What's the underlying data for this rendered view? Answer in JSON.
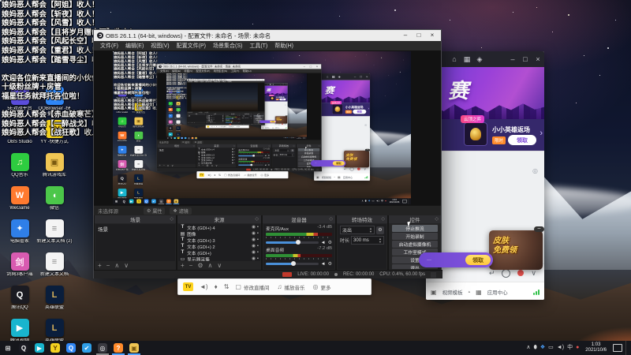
{
  "desktop": {
    "chat_lines": [
      "娘妈恶人帮会【阿姐】收人！",
      "娘妈恶人帮会【斩夜】收人！",
      "娘妈恶人帮会【风雪】收人！",
      "娘妈恶人帮会【且将岁月赠山河】收人！",
      "娘妈恶人帮会【风起长空】收人！",
      "娘妈恶人帮会【重君】收人！",
      "娘妈恶人帮会【踏雪寻尘】收人！",
      "",
      "欢迎各位新来直播间的小伙伴",
      "十级粉丝牌＋房管",
      "福星任务就拜托各位啦！",
      "",
      "娘妈恶人帮会【赤血破寒芒】收人！",
      "娘妈恶人帮会【一醉战戈】收人！",
      "娘妈恶人帮会【战狂歌】收人！"
    ],
    "icons_col1": [
      {
        "label": "5E对战平台",
        "glyph": "5E",
        "color": "#5b4ddb",
        "fg": "#ffffff"
      },
      {
        "label": "OBS Studio",
        "glyph": "◎",
        "color": "#17171d",
        "fg": "#ffffff"
      },
      {
        "label": "QQ音乐",
        "glyph": "♫",
        "color": "#2ecc40",
        "fg": "#fff7c0"
      },
      {
        "label": "WeGame",
        "glyph": "W",
        "color": "#ff7a2f",
        "fg": "#ffffff"
      },
      {
        "label": "电脑管家",
        "glyph": "✦",
        "color": "#2f7fe8",
        "fg": "#ffffff"
      },
      {
        "label": "剑网3客户端",
        "glyph": "剑",
        "color": "#d85bb0",
        "fg": "#ffe9f6"
      },
      {
        "label": "腾讯QQ",
        "glyph": "Q",
        "color": "#1b1b22",
        "fg": "#ffffff"
      },
      {
        "label": "腾讯视频",
        "glyph": "▶",
        "color": "#19b5ce",
        "fg": "#ffffff"
      }
    ],
    "icons_col2": [
      {
        "label": "QQBrowser -快捷方式",
        "glyph": "Q",
        "color": "#2f86f6",
        "fg": "#ffffff"
      },
      {
        "label": "YY -快捷方式",
        "glyph": "YY",
        "color": "#f4d21f",
        "fg": "#5a3a00"
      },
      {
        "label": "腾讯游戏库",
        "glyph": "▣",
        "color": "#f0c654",
        "fg": "#7a5a10"
      },
      {
        "label": "微信",
        "glyph": "◖",
        "color": "#4cc74a",
        "fg": "#ffffff"
      },
      {
        "label": "新建文本文档 (2)",
        "glyph": "≡",
        "color": "#f4f4f4",
        "fg": "#8a8a8a"
      },
      {
        "label": "新建文本文档",
        "glyph": "≡",
        "color": "#f4f4f4",
        "fg": "#8a8a8a"
      },
      {
        "label": "英雄联盟",
        "glyph": "L",
        "color": "#0a1e3c",
        "fg": "#d8b25a"
      },
      {
        "label": "英雄联盟WeGame版",
        "glyph": "L",
        "color": "#0a1e3c",
        "fg": "#d8b25a"
      }
    ]
  },
  "obs": {
    "title": "OBS 26.1.1 (64-bit, windows) - 配置文件: 未命名 - 场景: 未命名",
    "window_controls": {
      "min": "–",
      "max": "□",
      "close": "×"
    },
    "menus": [
      "文件(F)",
      "编辑(E)",
      "视图(V)",
      "配置文件(P)",
      "场景集合(S)",
      "工具(T)",
      "帮助(H)"
    ],
    "context_bar": {
      "no_source": "未选择源",
      "properties": "属性",
      "filters": "滤镜",
      "gear_icon": "⚙",
      "filter_icon": "❖"
    },
    "scenes": {
      "header": "场景",
      "items": [
        {
          "label": "场景"
        }
      ],
      "tools": [
        "+",
        "−",
        "∧",
        "∨"
      ]
    },
    "sources": {
      "header": "来源",
      "eye": "◉",
      "lock": "▪",
      "items": [
        {
          "glyph": "T",
          "label": "文本 (GDI+) 4"
        },
        {
          "glyph": "▤",
          "label": "图像"
        },
        {
          "glyph": "T",
          "label": "文本 (GDI+) 3"
        },
        {
          "glyph": "T",
          "label": "文本 (GDI+) 2"
        },
        {
          "glyph": "T",
          "label": "文本 (GDI+)"
        },
        {
          "glyph": "▭",
          "label": "显示器采集"
        }
      ],
      "tools": [
        "+",
        "−",
        "⚙",
        "∧",
        "∨"
      ]
    },
    "mixer": {
      "header": "混音器",
      "channels": [
        {
          "name": "麦克风/Aux",
          "db": "-3.4 dB",
          "level": "78%",
          "slider": "62%"
        },
        {
          "name": "桌面音频",
          "db": "-7.2 dB",
          "level": "52%",
          "slider": "52%"
        }
      ],
      "speaker_icon": "◄",
      "gear_icon": "⚙"
    },
    "transitions": {
      "header": "转场特效",
      "selected": "淡出",
      "duration_label": "时长",
      "duration_value": "300 ms",
      "gear_icon": "⚙"
    },
    "controls": {
      "header": "控件",
      "buttons": [
        {
          "label": "停止推流",
          "bg": "#5a5e64"
        },
        {
          "label": "开始录制",
          "bg": "#3e3e42"
        },
        {
          "label": "启动虚拟摄像机",
          "bg": "#3e3e42"
        },
        {
          "label": "工作室模式",
          "bg": "#3e3e42"
        },
        {
          "label": "设置",
          "bg": "#3e3e42"
        },
        {
          "label": "退出",
          "bg": "#3e3e42"
        }
      ]
    },
    "statusbar": {
      "live": "LIVE: 00:00:00",
      "rec": "REC: 00:00:00",
      "cpu": "CPU: 0.4%, 60.00 fps"
    }
  },
  "stream_toolbar": {
    "icons": {
      "speaker": "◄)",
      "mic": "♦",
      "sliders": "⇅"
    },
    "items": [
      {
        "glyph": "▢",
        "label": "修改直播间"
      },
      {
        "glyph": "♫",
        "label": "播放音乐"
      },
      {
        "glyph": "◎",
        "label": "更多"
      }
    ]
  },
  "right_app": {
    "topbar_icons": {
      "home": "⌂",
      "grid": "▦",
      "game": "◈",
      "min": "–",
      "max": "□",
      "close": "×"
    },
    "banner_title": "赛",
    "card": {
      "tag": "云顶之弈",
      "title": "小小英雄返场",
      "sub_tag": "限时",
      "button": "领取",
      "chevron": "›"
    },
    "pin_icon": "◎",
    "input_icons": {
      "enter": "↵",
      "caret": "∨"
    },
    "ad": {
      "line1": "皮肤",
      "line2": "免费领",
      "close": "–"
    },
    "toast": {
      "text": "···",
      "button": "领取"
    },
    "bottom_bar": {
      "cam_icon": "▣",
      "left": "视频模板",
      "caret": "▴",
      "grid_icon": "▦",
      "center": "应用中心"
    }
  },
  "taskbar": {
    "apps": [
      {
        "glyph": "⊞",
        "fg": "#ffffff",
        "bg": "transparent",
        "bar": "transparent"
      },
      {
        "glyph": "Q",
        "fg": "#ffffff",
        "bg": "#1b1b22",
        "bar": "transparent"
      },
      {
        "glyph": "▶",
        "fg": "#ffffff",
        "bg": "#19b5ce",
        "bar": "transparent"
      },
      {
        "glyph": "Y",
        "fg": "#5a3a00",
        "bg": "#f4d21f",
        "bar": "transparent"
      },
      {
        "glyph": "Q",
        "fg": "#ffffff",
        "bg": "#2f86f6",
        "bar": "transparent"
      },
      {
        "glyph": "✔",
        "fg": "#ffffff",
        "bg": "#2f9fe8",
        "bar": "transparent"
      },
      {
        "glyph": "◎",
        "fg": "#ffffff",
        "bg": "#3a3a40",
        "bar": "#8a8a8a"
      },
      {
        "glyph": "?",
        "fg": "#ffffff",
        "bg": "#ff8a2a",
        "bar": "#4da3ff"
      },
      {
        "glyph": "▣",
        "fg": "#7a5a10",
        "bg": "#f0c654",
        "bar": "#4da3ff"
      }
    ],
    "tray": {
      "caret": "∧",
      "mic": "⬮",
      "shield": "❖",
      "monitor": "▭",
      "speaker": "◄)",
      "ime": "中",
      "dot": "●",
      "time": "1:03",
      "date": "2021/10/6"
    }
  }
}
